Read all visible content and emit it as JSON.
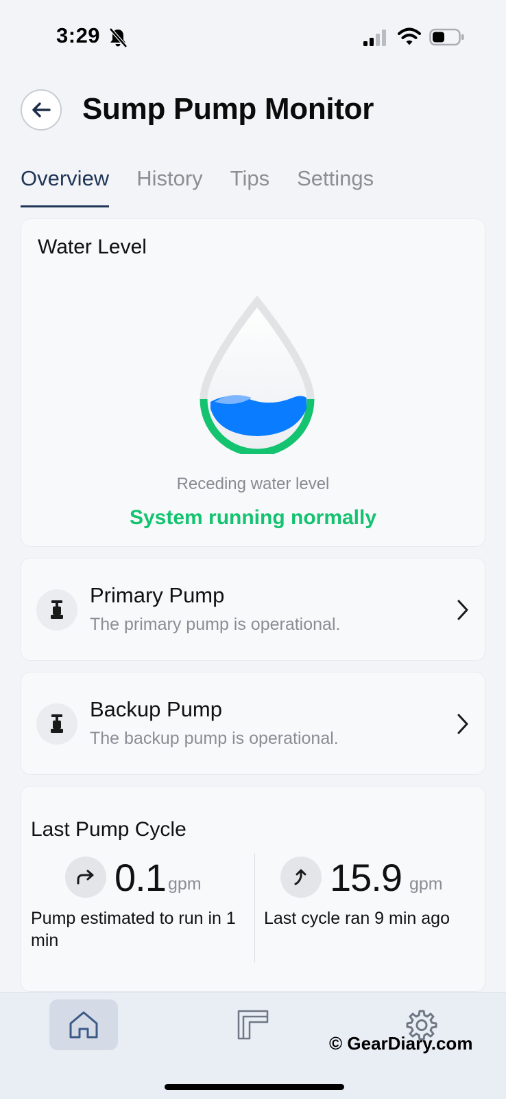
{
  "status_bar": {
    "time": "3:29",
    "icons": [
      "bell-slash-icon",
      "cellular-signal-icon",
      "wifi-icon",
      "battery-icon"
    ]
  },
  "header": {
    "title": "Sump Pump Monitor",
    "back_icon": "arrow-left-icon"
  },
  "tabs": [
    {
      "label": "Overview",
      "active": true
    },
    {
      "label": "History",
      "active": false
    },
    {
      "label": "Tips",
      "active": false
    },
    {
      "label": "Settings",
      "active": false
    }
  ],
  "water_level": {
    "title": "Water Level",
    "trend": "Receding water level",
    "status": "System running normally",
    "status_color": "#13c36f",
    "water_color": "#0a7cff"
  },
  "pumps": [
    {
      "title": "Primary Pump",
      "subtitle": "The primary pump is operational.",
      "icon": "pump-icon"
    },
    {
      "title": "Backup Pump",
      "subtitle": "The backup pump is operational.",
      "icon": "pump-icon"
    }
  ],
  "last_cycle": {
    "title": "Last Pump Cycle",
    "metrics": [
      {
        "value": "0.1",
        "unit": "gpm",
        "description": "Pump estimated to run in 1 min",
        "icon": "redo-arrow-icon"
      },
      {
        "value": "15.9",
        "unit": "gpm",
        "description": "Last cycle ran 9 min ago",
        "icon": "curved-up-arrow-icon"
      }
    ]
  },
  "bottom_nav": [
    {
      "name": "home",
      "icon": "home-icon",
      "active": true
    },
    {
      "name": "history",
      "icon": "history-icon",
      "active": false
    },
    {
      "name": "settings",
      "icon": "gear-icon",
      "active": false
    }
  ],
  "watermark": "© GearDiary.com",
  "accent_color": "#1f3556"
}
